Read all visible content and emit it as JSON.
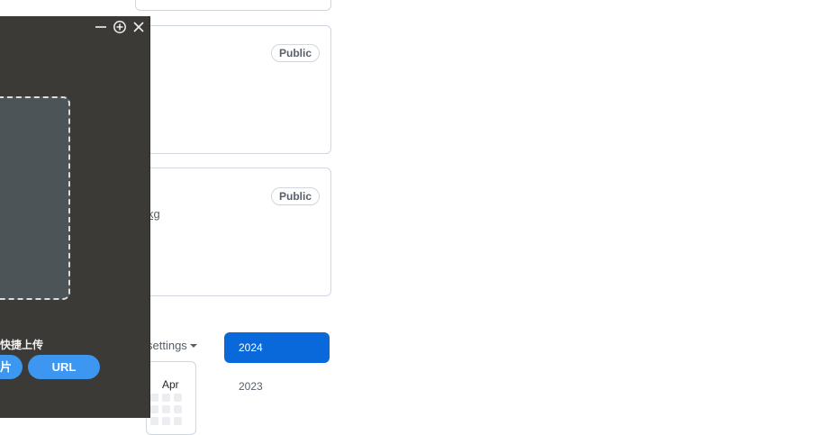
{
  "cards": [
    {
      "badge": "Public",
      "link": ""
    },
    {
      "badge": "Public",
      "link": "kg"
    }
  ],
  "contrib": {
    "settings_label": "settings",
    "month_label": "Apr"
  },
  "years": {
    "active": "2024",
    "other": "2023"
  },
  "upload_panel": {
    "title": "快捷上传",
    "left_button": "图片",
    "url_button": "URL",
    "icons": [
      "minimize-icon",
      "add-circle-icon",
      "close-icon"
    ]
  },
  "colors": {
    "accent": "#0969da",
    "panel_bg": "#3b3a36",
    "pill_bg": "#3d96f0",
    "border": "#d0d7de"
  }
}
